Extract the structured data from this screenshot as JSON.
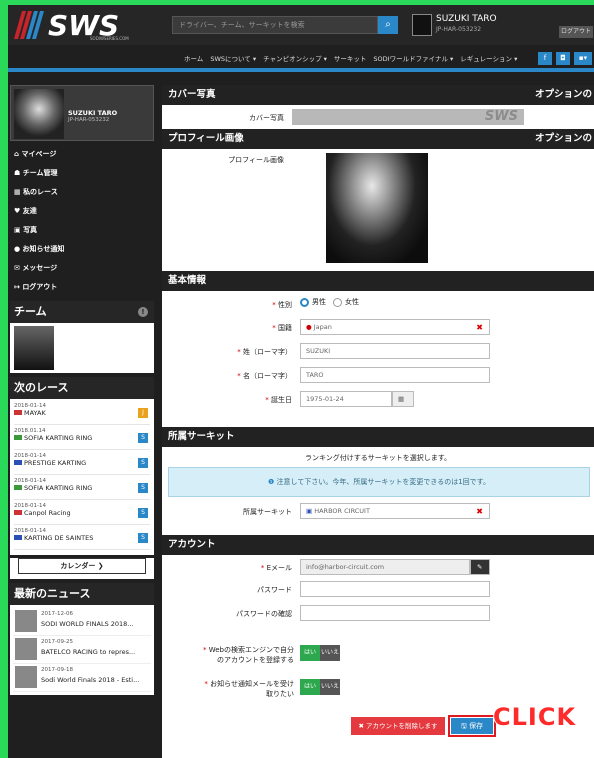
{
  "header": {
    "logo_text": "SWS",
    "logo_tagline": "SODIWSERIES.COM",
    "search_placeholder": "ドライバー、チーム、サーキットを検索",
    "user_name": "SUZUKI TARO",
    "user_id": "JP-HAR-053232",
    "logout_label": "ログアウト"
  },
  "nav": {
    "items": [
      "ホーム",
      "SWSについて ▾",
      "チャンピオンシップ ▾",
      "サーキット",
      "SODIワールドファイナル ▾",
      "レギュレーション ▾"
    ],
    "social_colors": [
      "#2a87c8",
      "#2a87c8",
      "#2a87c8"
    ]
  },
  "sidebar": {
    "profile_name": "SUZUKI TARO",
    "profile_id": "JP-HAR-053232",
    "menu": [
      {
        "icon": "home-icon",
        "glyph": "⌂",
        "label": "マイページ"
      },
      {
        "icon": "team-icon",
        "glyph": "☗",
        "label": "チーム管理"
      },
      {
        "icon": "calendar-icon",
        "glyph": "▦",
        "label": "私のレース"
      },
      {
        "icon": "heart-icon",
        "glyph": "♥",
        "label": "友達"
      },
      {
        "icon": "photo-icon",
        "glyph": "▣",
        "label": "写真"
      },
      {
        "icon": "bell-icon",
        "glyph": "●",
        "label": "お知らせ通知"
      },
      {
        "icon": "mail-icon",
        "glyph": "✉",
        "label": "メッセージ"
      },
      {
        "icon": "logout-icon",
        "glyph": "↦",
        "label": "ログアウト"
      }
    ],
    "team_title": "チーム",
    "team_badge": "!",
    "next_races_title": "次のレース",
    "races": [
      {
        "date": "2018-01-14",
        "name": "MAYAK",
        "badge": "J",
        "badge_color": "#e8a21c",
        "flag": "#c33"
      },
      {
        "date": "2018.01.14",
        "name": "SOFIA KARTING RING",
        "badge": "S",
        "badge_color": "#2a87c8",
        "flag": "#3a9a3a"
      },
      {
        "date": "2018-01-14",
        "name": "PRESTIGE KARTING",
        "badge": "S",
        "badge_color": "#2a87c8",
        "flag": "#2a4fb5"
      },
      {
        "date": "2018-01-14",
        "name": "SOFIA KARTING RING",
        "badge": "S",
        "badge_color": "#2a87c8",
        "flag": "#3a9a3a"
      },
      {
        "date": "2018-01-14",
        "name": "Canpol Racing",
        "badge": "S",
        "badge_color": "#2a87c8",
        "flag": "#c33"
      },
      {
        "date": "2018-01-14",
        "name": "KARTING DE SAINTES",
        "badge": "S",
        "badge_color": "#2a87c8",
        "flag": "#2a4fb5"
      }
    ],
    "calendar_label": "カレンダー ❯",
    "news_title": "最新のニュース",
    "news": [
      {
        "date": "2017-12-06",
        "title": "SODI WORLD FINALS 2018..."
      },
      {
        "date": "2017-09-25",
        "title": "BATELCO RACING to repres..."
      },
      {
        "date": "2017-09-18",
        "title": "Sodi World Finals 2018 - Esti..."
      }
    ]
  },
  "cover": {
    "title": "カバー写真",
    "option": "オプションの",
    "field_label": "カバー写真",
    "image_text": "SWS"
  },
  "profile_image": {
    "title": "プロフィール画像",
    "option": "オプションの",
    "field_label": "プロフィール画像"
  },
  "basic": {
    "title": "基本情報",
    "gender_label": "性別",
    "gender_male": "男性",
    "gender_female": "女性",
    "country_label": "国籍",
    "country_value": "Japan",
    "lastname_label": "姓（ローマ字）",
    "lastname_value": "SUZUKI",
    "firstname_label": "名（ローマ字）",
    "firstname_value": "TARO",
    "birthday_label": "誕生日",
    "birthday_value": "1975-01-24"
  },
  "circuit": {
    "title": "所属サーキット",
    "intro": "ランキング付けするサーキットを選択します。",
    "notice": "注意して下さい。今年、所属サーキットを変更できるのは1回です。",
    "field_label": "所属サーキット",
    "field_value": "HARBOR CIRCUIT"
  },
  "account": {
    "title": "アカウント",
    "email_label": "Eメール",
    "email_value": "info@harbor-circuit.com",
    "password_label": "パスワード",
    "password_confirm_label": "パスワードの確認",
    "search_engine_label_1": "Webの検索エンジンで自分",
    "search_engine_label_2": "のアカウントを登録する",
    "notify_label_1": "お知らせ通知メールを受け",
    "notify_label_2": "取りたい",
    "yes": "はい",
    "no": "いいえ",
    "delete_label": "✖ アカウントを削除します",
    "save_label": "🖫 保存"
  },
  "annotation": {
    "click_text": "CLICK"
  }
}
